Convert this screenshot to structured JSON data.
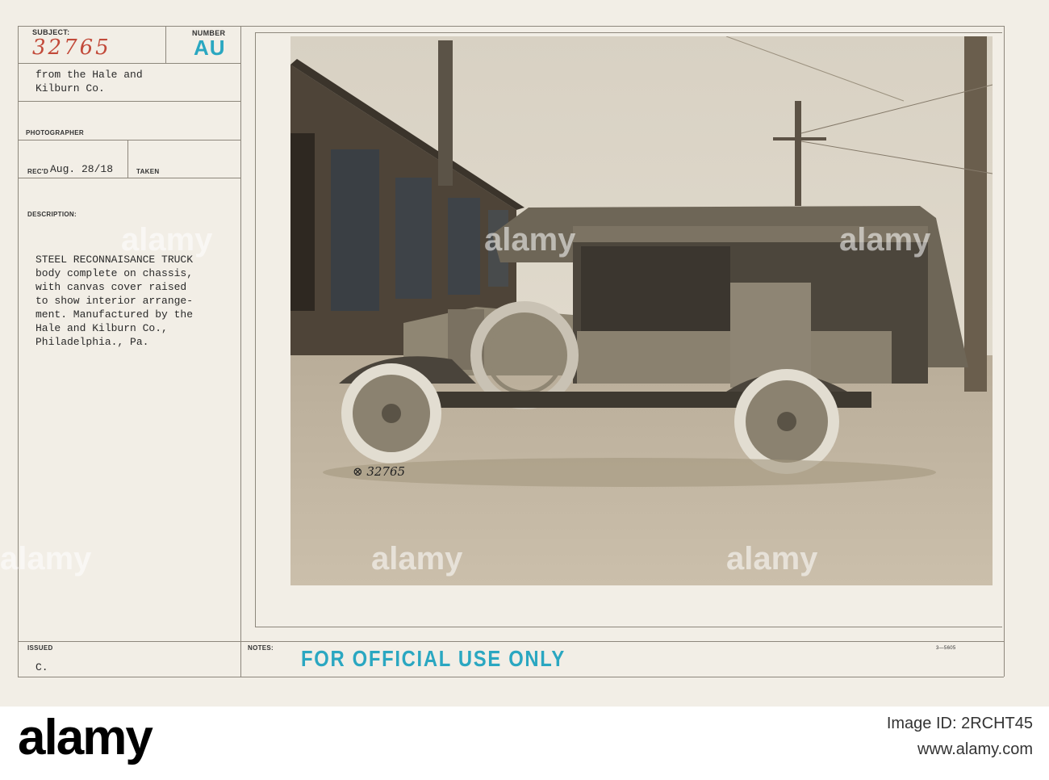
{
  "card": {
    "subject_label": "SUBJECT:",
    "subject_value": "32765",
    "number_label": "NUMBER",
    "number_value": "AU",
    "source_lines": [
      "from the Hale and",
      "Kilburn Co."
    ],
    "photographer_label": "PHOTOGRAPHER",
    "recd_label": "REC'D",
    "recd_value": "Aug. 28/18",
    "taken_label": "TAKEN",
    "description_label": "DESCRIPTION:",
    "description_lines": [
      "STEEL RECONNAISANCE TRUCK",
      "body complete on chassis,",
      "with canvas cover raised",
      "to show interior arrange-",
      "ment. Manufactured by the",
      "Hale and Kilburn Co.,",
      "Philadelphia., Pa."
    ],
    "issued_label": "ISSUED",
    "issued_value": "C.",
    "notes_label": "NOTES:",
    "stamp": "FOR OFFICIAL USE ONLY",
    "form_number": "3—5605"
  },
  "photo": {
    "negative_number": "⊗ 32765"
  },
  "watermarks": [
    "alamy",
    "alamy",
    "alamy",
    "alamy",
    "alamy",
    "alamy"
  ],
  "footer": {
    "logo_text": "alamy",
    "image_id_label": "Image ID: 2RCHT45",
    "url": "www.alamy.com"
  }
}
